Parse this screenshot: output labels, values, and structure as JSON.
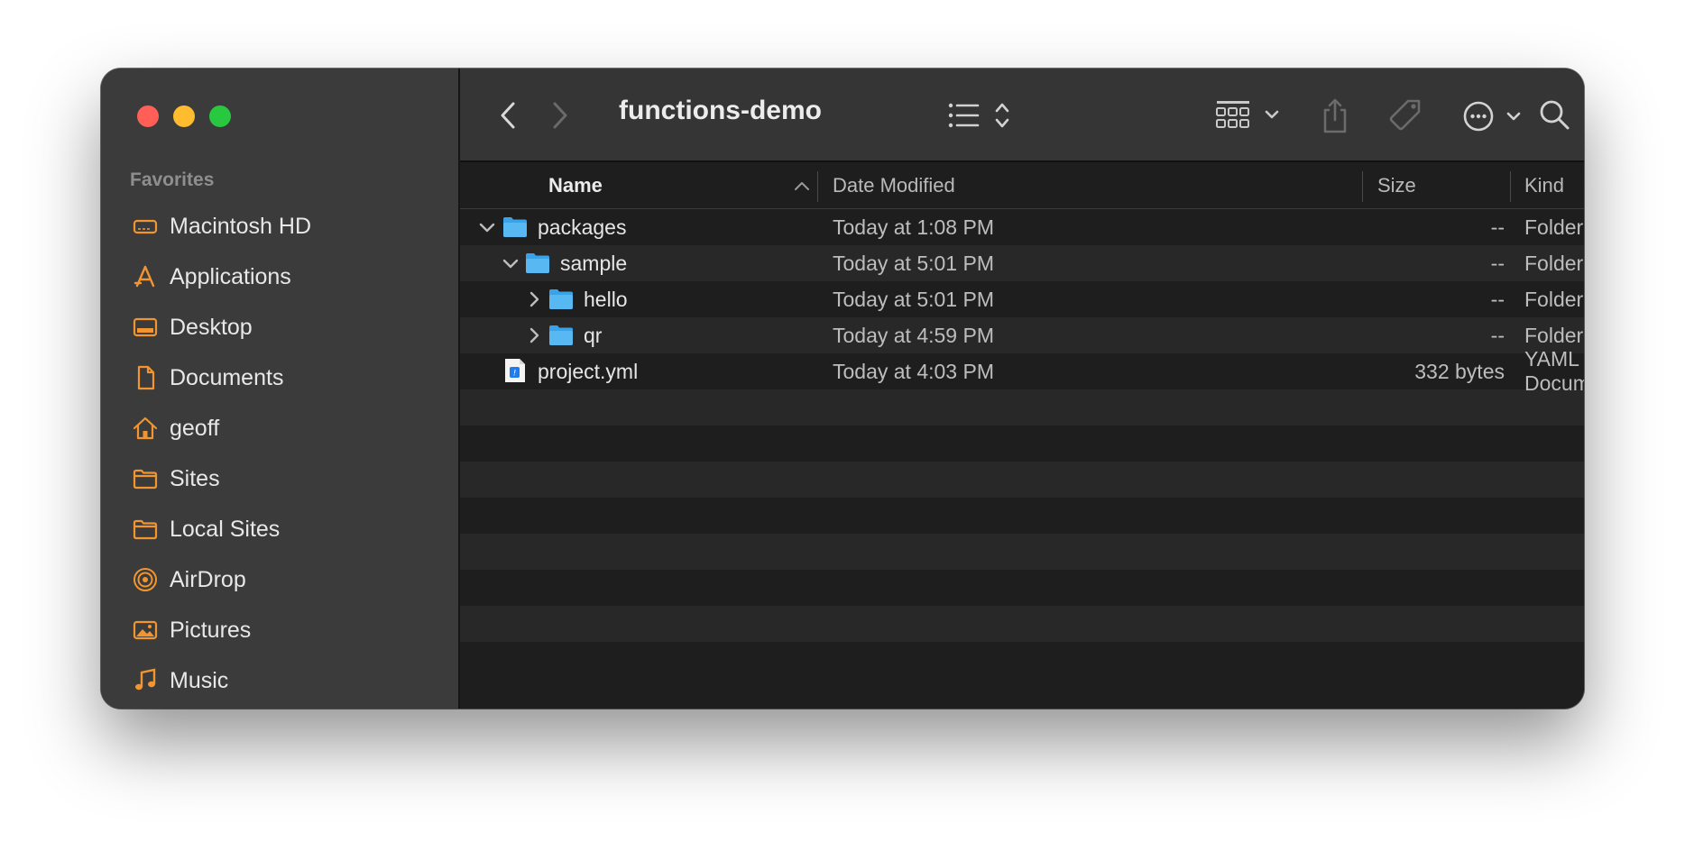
{
  "window": {
    "title": "functions-demo"
  },
  "sidebar": {
    "heading": "Favorites",
    "items": [
      {
        "label": "Macintosh HD",
        "icon": "disk-icon"
      },
      {
        "label": "Applications",
        "icon": "applications-icon"
      },
      {
        "label": "Desktop",
        "icon": "desktop-icon"
      },
      {
        "label": "Documents",
        "icon": "document-icon"
      },
      {
        "label": "geoff",
        "icon": "home-icon"
      },
      {
        "label": "Sites",
        "icon": "folder-icon"
      },
      {
        "label": "Local Sites",
        "icon": "folder-icon"
      },
      {
        "label": "AirDrop",
        "icon": "airdrop-icon"
      },
      {
        "label": "Pictures",
        "icon": "pictures-icon"
      },
      {
        "label": "Music",
        "icon": "music-icon"
      }
    ]
  },
  "columns": {
    "name": "Name",
    "date": "Date Modified",
    "size": "Size",
    "kind": "Kind"
  },
  "rows": [
    {
      "name": "packages",
      "date": "Today at 1:08 PM",
      "size": "--",
      "kind": "Folder",
      "type": "folder",
      "expanded": true,
      "depth": 0
    },
    {
      "name": "sample",
      "date": "Today at 5:01 PM",
      "size": "--",
      "kind": "Folder",
      "type": "folder",
      "expanded": true,
      "depth": 1
    },
    {
      "name": "hello",
      "date": "Today at 5:01 PM",
      "size": "--",
      "kind": "Folder",
      "type": "folder",
      "expanded": false,
      "depth": 2
    },
    {
      "name": "qr",
      "date": "Today at 4:59 PM",
      "size": "--",
      "kind": "Folder",
      "type": "folder",
      "expanded": false,
      "depth": 2
    },
    {
      "name": "project.yml",
      "date": "Today at 4:03 PM",
      "size": "332 bytes",
      "kind": "YAML Document",
      "type": "file",
      "depth": 0
    }
  ],
  "colors": {
    "accent": "#f0952f",
    "folder": "#3aa3e8",
    "sidebar_bg": "#3c3b3c",
    "toolbar_bg": "#353535"
  }
}
